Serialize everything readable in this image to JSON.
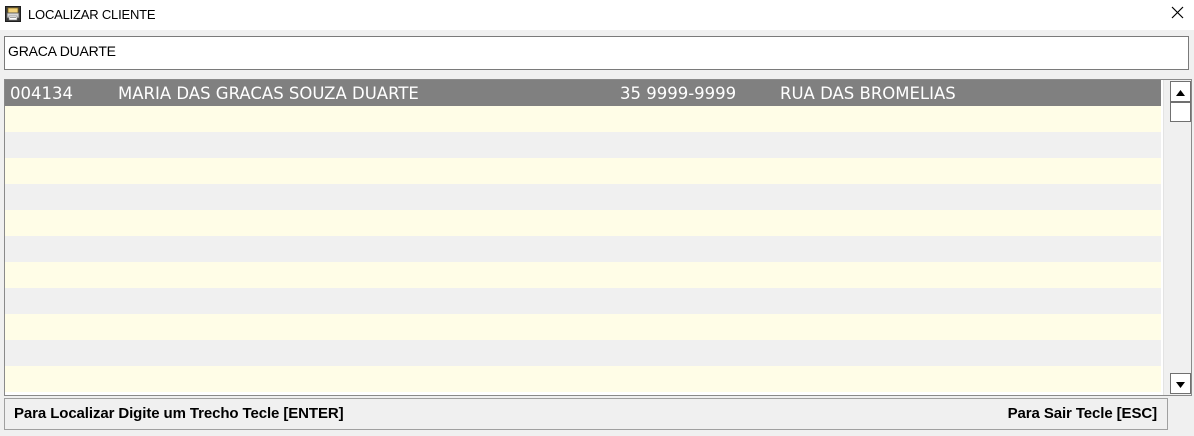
{
  "window": {
    "title": "LOCALIZAR CLIENTE",
    "icon": "printer-app-icon",
    "close_icon": "close-icon"
  },
  "search": {
    "value": "GRACA DUARTE"
  },
  "results": {
    "rows": [
      {
        "code": "004134",
        "name": "MARIA DAS GRACAS SOUZA DUARTE",
        "phone": "35 9999-9999",
        "address": "RUA DAS BROMELIAS",
        "selected": true
      },
      {
        "code": "",
        "name": "",
        "phone": "",
        "address": ""
      },
      {
        "code": "",
        "name": "",
        "phone": "",
        "address": ""
      },
      {
        "code": "",
        "name": "",
        "phone": "",
        "address": ""
      },
      {
        "code": "",
        "name": "",
        "phone": "",
        "address": ""
      },
      {
        "code": "",
        "name": "",
        "phone": "",
        "address": ""
      },
      {
        "code": "",
        "name": "",
        "phone": "",
        "address": ""
      },
      {
        "code": "",
        "name": "",
        "phone": "",
        "address": ""
      },
      {
        "code": "",
        "name": "",
        "phone": "",
        "address": ""
      },
      {
        "code": "",
        "name": "",
        "phone": "",
        "address": ""
      },
      {
        "code": "",
        "name": "",
        "phone": "",
        "address": ""
      },
      {
        "code": "",
        "name": "",
        "phone": "",
        "address": ""
      }
    ],
    "colors": {
      "selected_bg": "#808080",
      "stripe_a": "#fffde7",
      "stripe_b": "#f0f0f0"
    }
  },
  "status": {
    "left": "Para Localizar Digite um Trecho Tecle [ENTER]",
    "right": "Para Sair Tecle [ESC]"
  }
}
